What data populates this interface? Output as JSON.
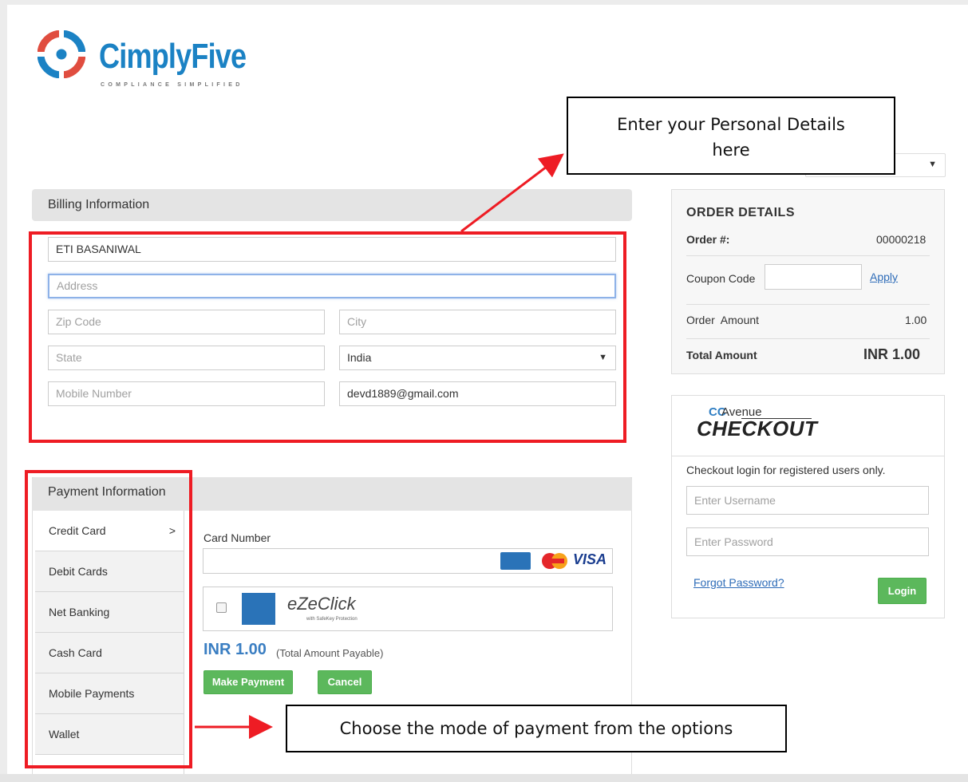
{
  "brand": {
    "name": "CimplyFive",
    "tagline": "COMPLIANCE SIMPLIFIED",
    "colors": {
      "blue": "#1b82c4",
      "red": "#e04d3f"
    }
  },
  "billing": {
    "header": "Billing Information",
    "name_value": "ETI BASANIWAL",
    "address_placeholder": "Address",
    "zip_placeholder": "Zip Code",
    "city_placeholder": "City",
    "state_placeholder": "State",
    "country_value": "India",
    "mobile_placeholder": "Mobile Number",
    "email_value": "devd1889@gmail.com"
  },
  "payment": {
    "header": "Payment Information",
    "tabs": [
      {
        "label": "Credit Card",
        "active": true
      },
      {
        "label": "Debit Cards"
      },
      {
        "label": "Net Banking"
      },
      {
        "label": "Cash Card"
      },
      {
        "label": "Mobile Payments"
      },
      {
        "label": "Wallet"
      }
    ],
    "card_number_label": "Card Number",
    "card_brand_visa": "VISA",
    "ezeclick_label": "eZeClick",
    "ezeclick_sub": "with SafeKey Protection",
    "amount": "INR 1.00",
    "amount_note": "(Total Amount Payable)",
    "make_payment_label": "Make Payment",
    "cancel_label": "Cancel"
  },
  "order": {
    "title": "ORDER DETAILS",
    "order_no_label": "Order #:",
    "order_no_value": "00000218",
    "coupon_label": "Coupon Code",
    "apply_label": "Apply",
    "order_amount_label": "Order  Amount",
    "order_amount_value": "1.00",
    "total_label": "Total Amount",
    "total_value": "INR 1.00"
  },
  "checkout": {
    "cc_label": "CC",
    "avenue_label": "Avenue",
    "checkout_label": "CHECKOUT",
    "note": "Checkout login for registered users only.",
    "username_placeholder": "Enter Username",
    "password_placeholder": "Enter Password",
    "forgot_label": "Forgot Password?",
    "login_label": "Login"
  },
  "callouts": {
    "personal_details_line1": "Enter your Personal Details",
    "personal_details_line2": "here",
    "payment_mode": "Choose the mode of payment from the options"
  },
  "theme": {
    "annotation_red": "#ee1c24",
    "button_green": "#5cb85c",
    "link_blue": "#2e6cb8"
  }
}
